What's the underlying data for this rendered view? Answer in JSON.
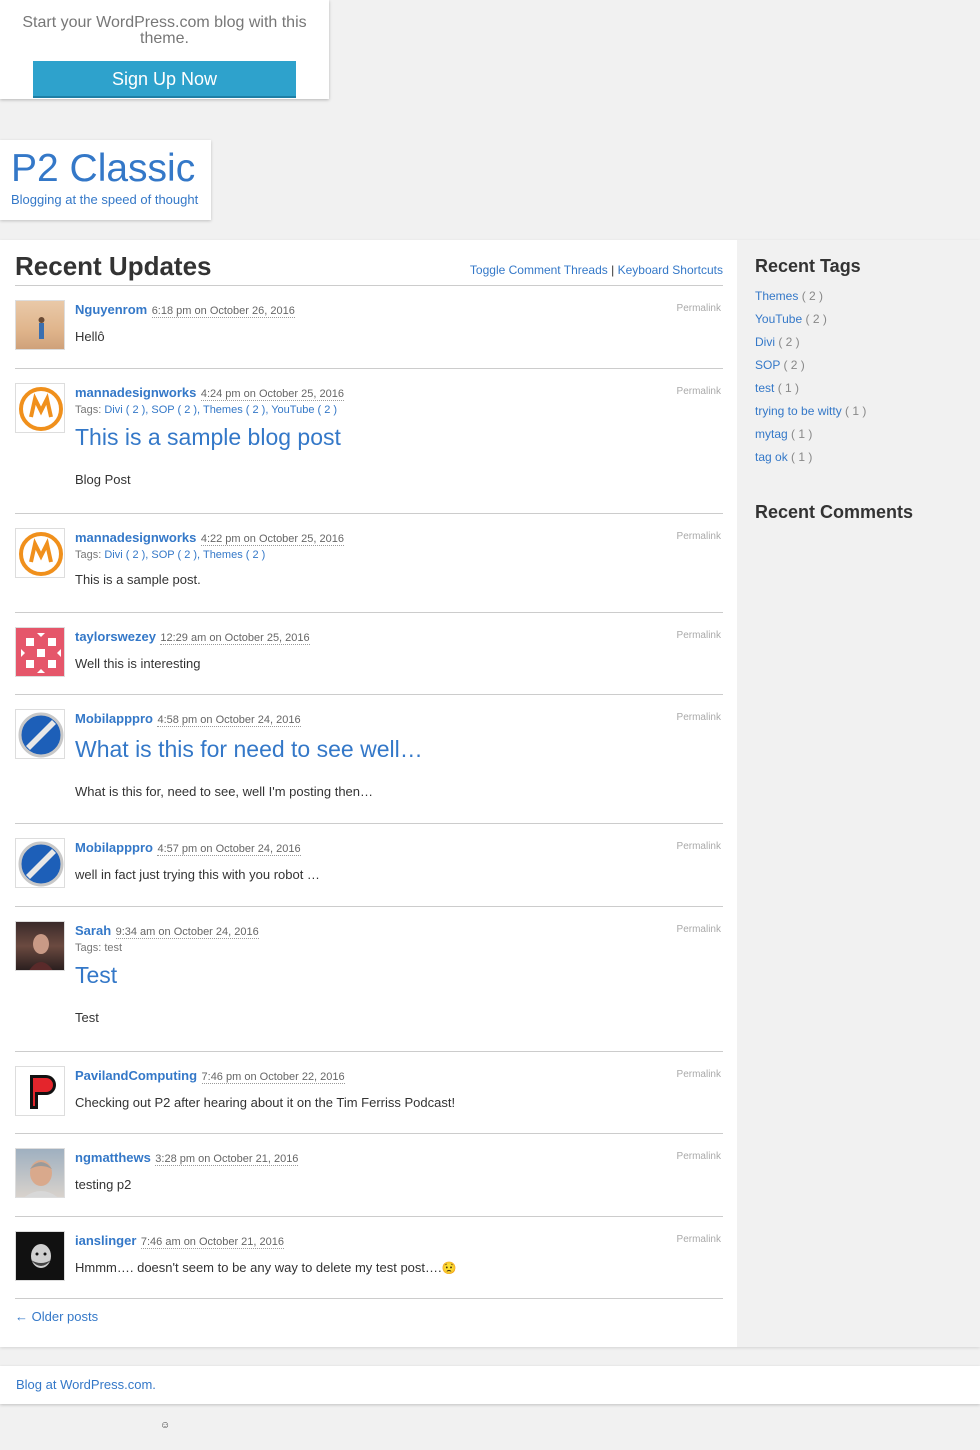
{
  "signup": {
    "text": "Start your WordPress.com blog with this theme.",
    "button": "Sign Up Now"
  },
  "header": {
    "title": "P2 Classic",
    "description": "Blogging at the speed of thought"
  },
  "main": {
    "title": "Recent Updates",
    "toggle_link": "Toggle Comment Threads",
    "separator": "|",
    "shortcuts_link": "Keyboard Shortcuts",
    "permalink_label": "Permalink",
    "older_posts": "← Older posts"
  },
  "posts": [
    {
      "author": "Nguyenrom",
      "time": "6:18 pm",
      "on": "on",
      "date": "October 26, 2016",
      "text": "Hellô"
    },
    {
      "author": "mannadesignworks",
      "time": "4:24 pm",
      "on": "on",
      "date": "October 25, 2016",
      "tags_label": "Tags:",
      "tags": "Divi ( 2 ), SOP ( 2 ), Themes ( 2 ), YouTube ( 2 )",
      "title": "This is a sample blog post",
      "text": "Blog Post"
    },
    {
      "author": "mannadesignworks",
      "time": "4:22 pm",
      "on": "on",
      "date": "October 25, 2016",
      "tags_label": "Tags:",
      "tags": "Divi ( 2 ), SOP ( 2 ), Themes ( 2 )",
      "text": "This is a sample post."
    },
    {
      "author": "taylorswezey",
      "time": "12:29 am",
      "on": "on",
      "date": "October 25, 2016",
      "text": "Well this is interesting"
    },
    {
      "author": "Mobilapppro",
      "time": "4:58 pm",
      "on": "on",
      "date": "October 24, 2016",
      "title": "What is this for need to see well…",
      "text": "What is this for, need to see, well I'm posting then…"
    },
    {
      "author": "Mobilapppro",
      "time": "4:57 pm",
      "on": "on",
      "date": "October 24, 2016",
      "text": "well in fact just trying this with you robot …"
    },
    {
      "author": "Sarah",
      "time": "9:34 am",
      "on": "on",
      "date": "October 24, 2016",
      "tags_label": "Tags:",
      "tags": "test",
      "title": "Test",
      "text": "Test"
    },
    {
      "author": "PavilandComputing",
      "time": "7:46 pm",
      "on": "on",
      "date": "October 22, 2016",
      "text": "Checking out P2 after hearing about it on the Tim Ferriss Podcast!"
    },
    {
      "author": "ngmatthews",
      "time": "3:28 pm",
      "on": "on",
      "date": "October 21, 2016",
      "text": "testing p2"
    },
    {
      "author": "ianslinger",
      "time": "7:46 am",
      "on": "on",
      "date": "October 21, 2016",
      "text": "Hmmm…. doesn't seem to be any way to delete my test post….",
      "emoji": "😟"
    }
  ],
  "sidebar": {
    "tags_title": "Recent Tags",
    "tags": [
      {
        "name": "Themes",
        "count": "( 2 )"
      },
      {
        "name": "YouTube",
        "count": "( 2 )"
      },
      {
        "name": "Divi",
        "count": "( 2 )"
      },
      {
        "name": "SOP",
        "count": "( 2 )"
      },
      {
        "name": "test",
        "count": "( 1 )"
      },
      {
        "name": "trying to be witty",
        "count": "( 1 )"
      },
      {
        "name": "mytag",
        "count": "( 1 )"
      },
      {
        "name": "tag ok",
        "count": "( 1 )"
      }
    ],
    "comments_title": "Recent Comments"
  },
  "footer": {
    "text": "Blog at WordPress.com."
  },
  "colors": {
    "link": "#3478c8",
    "button": "#2ea2cc",
    "background": "#f1f1f1"
  }
}
